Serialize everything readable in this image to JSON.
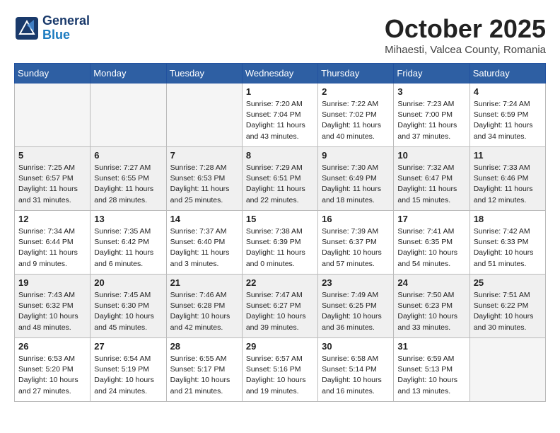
{
  "header": {
    "logo_line1": "General",
    "logo_line2": "Blue",
    "month": "October 2025",
    "location": "Mihaesti, Valcea County, Romania"
  },
  "days_of_week": [
    "Sunday",
    "Monday",
    "Tuesday",
    "Wednesday",
    "Thursday",
    "Friday",
    "Saturday"
  ],
  "weeks": [
    [
      {
        "day": "",
        "info": ""
      },
      {
        "day": "",
        "info": ""
      },
      {
        "day": "",
        "info": ""
      },
      {
        "day": "1",
        "info": "Sunrise: 7:20 AM\nSunset: 7:04 PM\nDaylight: 11 hours\nand 43 minutes."
      },
      {
        "day": "2",
        "info": "Sunrise: 7:22 AM\nSunset: 7:02 PM\nDaylight: 11 hours\nand 40 minutes."
      },
      {
        "day": "3",
        "info": "Sunrise: 7:23 AM\nSunset: 7:00 PM\nDaylight: 11 hours\nand 37 minutes."
      },
      {
        "day": "4",
        "info": "Sunrise: 7:24 AM\nSunset: 6:59 PM\nDaylight: 11 hours\nand 34 minutes."
      }
    ],
    [
      {
        "day": "5",
        "info": "Sunrise: 7:25 AM\nSunset: 6:57 PM\nDaylight: 11 hours\nand 31 minutes."
      },
      {
        "day": "6",
        "info": "Sunrise: 7:27 AM\nSunset: 6:55 PM\nDaylight: 11 hours\nand 28 minutes."
      },
      {
        "day": "7",
        "info": "Sunrise: 7:28 AM\nSunset: 6:53 PM\nDaylight: 11 hours\nand 25 minutes."
      },
      {
        "day": "8",
        "info": "Sunrise: 7:29 AM\nSunset: 6:51 PM\nDaylight: 11 hours\nand 22 minutes."
      },
      {
        "day": "9",
        "info": "Sunrise: 7:30 AM\nSunset: 6:49 PM\nDaylight: 11 hours\nand 18 minutes."
      },
      {
        "day": "10",
        "info": "Sunrise: 7:32 AM\nSunset: 6:47 PM\nDaylight: 11 hours\nand 15 minutes."
      },
      {
        "day": "11",
        "info": "Sunrise: 7:33 AM\nSunset: 6:46 PM\nDaylight: 11 hours\nand 12 minutes."
      }
    ],
    [
      {
        "day": "12",
        "info": "Sunrise: 7:34 AM\nSunset: 6:44 PM\nDaylight: 11 hours\nand 9 minutes."
      },
      {
        "day": "13",
        "info": "Sunrise: 7:35 AM\nSunset: 6:42 PM\nDaylight: 11 hours\nand 6 minutes."
      },
      {
        "day": "14",
        "info": "Sunrise: 7:37 AM\nSunset: 6:40 PM\nDaylight: 11 hours\nand 3 minutes."
      },
      {
        "day": "15",
        "info": "Sunrise: 7:38 AM\nSunset: 6:39 PM\nDaylight: 11 hours\nand 0 minutes."
      },
      {
        "day": "16",
        "info": "Sunrise: 7:39 AM\nSunset: 6:37 PM\nDaylight: 10 hours\nand 57 minutes."
      },
      {
        "day": "17",
        "info": "Sunrise: 7:41 AM\nSunset: 6:35 PM\nDaylight: 10 hours\nand 54 minutes."
      },
      {
        "day": "18",
        "info": "Sunrise: 7:42 AM\nSunset: 6:33 PM\nDaylight: 10 hours\nand 51 minutes."
      }
    ],
    [
      {
        "day": "19",
        "info": "Sunrise: 7:43 AM\nSunset: 6:32 PM\nDaylight: 10 hours\nand 48 minutes."
      },
      {
        "day": "20",
        "info": "Sunrise: 7:45 AM\nSunset: 6:30 PM\nDaylight: 10 hours\nand 45 minutes."
      },
      {
        "day": "21",
        "info": "Sunrise: 7:46 AM\nSunset: 6:28 PM\nDaylight: 10 hours\nand 42 minutes."
      },
      {
        "day": "22",
        "info": "Sunrise: 7:47 AM\nSunset: 6:27 PM\nDaylight: 10 hours\nand 39 minutes."
      },
      {
        "day": "23",
        "info": "Sunrise: 7:49 AM\nSunset: 6:25 PM\nDaylight: 10 hours\nand 36 minutes."
      },
      {
        "day": "24",
        "info": "Sunrise: 7:50 AM\nSunset: 6:23 PM\nDaylight: 10 hours\nand 33 minutes."
      },
      {
        "day": "25",
        "info": "Sunrise: 7:51 AM\nSunset: 6:22 PM\nDaylight: 10 hours\nand 30 minutes."
      }
    ],
    [
      {
        "day": "26",
        "info": "Sunrise: 6:53 AM\nSunset: 5:20 PM\nDaylight: 10 hours\nand 27 minutes."
      },
      {
        "day": "27",
        "info": "Sunrise: 6:54 AM\nSunset: 5:19 PM\nDaylight: 10 hours\nand 24 minutes."
      },
      {
        "day": "28",
        "info": "Sunrise: 6:55 AM\nSunset: 5:17 PM\nDaylight: 10 hours\nand 21 minutes."
      },
      {
        "day": "29",
        "info": "Sunrise: 6:57 AM\nSunset: 5:16 PM\nDaylight: 10 hours\nand 19 minutes."
      },
      {
        "day": "30",
        "info": "Sunrise: 6:58 AM\nSunset: 5:14 PM\nDaylight: 10 hours\nand 16 minutes."
      },
      {
        "day": "31",
        "info": "Sunrise: 6:59 AM\nSunset: 5:13 PM\nDaylight: 10 hours\nand 13 minutes."
      },
      {
        "day": "",
        "info": ""
      }
    ]
  ]
}
